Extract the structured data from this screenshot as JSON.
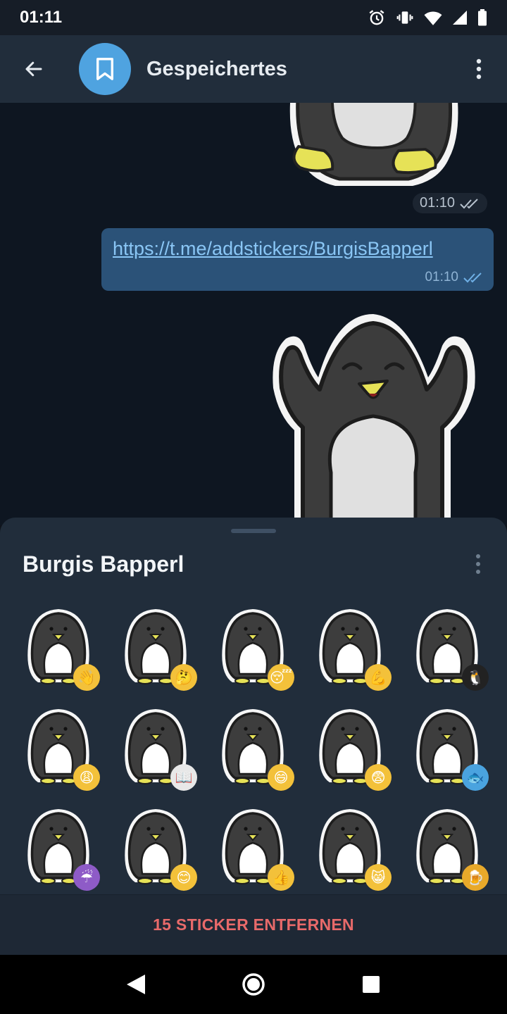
{
  "status_bar": {
    "time": "01:11",
    "icons": [
      "alarm-icon",
      "vibrate-icon",
      "wifi-icon",
      "signal-icon",
      "battery-icon"
    ]
  },
  "header": {
    "title": "Gespeichertes",
    "avatar_icon": "bookmark-icon",
    "back_icon": "arrow-back-icon",
    "menu_icon": "more-vertical-icon"
  },
  "messages": [
    {
      "type": "sticker",
      "time": "01:10",
      "status": "read"
    },
    {
      "type": "text",
      "text": "https://t.me/addstickers/BurgisBapperl",
      "time": "01:10",
      "status": "read"
    },
    {
      "type": "sticker",
      "time": ""
    }
  ],
  "sticker_sheet": {
    "title": "Burgis Bapperl",
    "menu_icon": "more-vertical-icon",
    "stickers": [
      {
        "emoji": "👋",
        "badge_color": "#f3c13a"
      },
      {
        "emoji": "🤔",
        "badge_color": "#f3c13a"
      },
      {
        "emoji": "😴",
        "badge_color": "#f3c13a"
      },
      {
        "emoji": "💪",
        "badge_color": "#f3c13a"
      },
      {
        "emoji": "🐧",
        "badge_color": "#222222"
      },
      {
        "emoji": "😩",
        "badge_color": "#f3c13a"
      },
      {
        "emoji": "📖",
        "badge_color": "#e8e8e8"
      },
      {
        "emoji": "😄",
        "badge_color": "#f3c13a"
      },
      {
        "emoji": "😨",
        "badge_color": "#f3c13a"
      },
      {
        "emoji": "🐟",
        "badge_color": "#4aa3df"
      },
      {
        "emoji": "☔",
        "badge_color": "#8e5bc7"
      },
      {
        "emoji": "😊",
        "badge_color": "#f3c13a"
      },
      {
        "emoji": "👍",
        "badge_color": "#f3c13a"
      },
      {
        "emoji": "😸",
        "badge_color": "#f3c13a"
      },
      {
        "emoji": "🍺",
        "badge_color": "#e8a92a"
      }
    ],
    "remove_label": "15 STICKER ENTFERNEN"
  },
  "nav_bar": {
    "icons": [
      "nav-back-icon",
      "nav-home-icon",
      "nav-recents-icon"
    ]
  },
  "colors": {
    "header_bg": "#212d3b",
    "chat_bg": "#0e1621",
    "bubble_bg": "#2b5278",
    "link": "#8ac6f5",
    "danger": "#e86a6a",
    "accent": "#4fa3e0"
  }
}
